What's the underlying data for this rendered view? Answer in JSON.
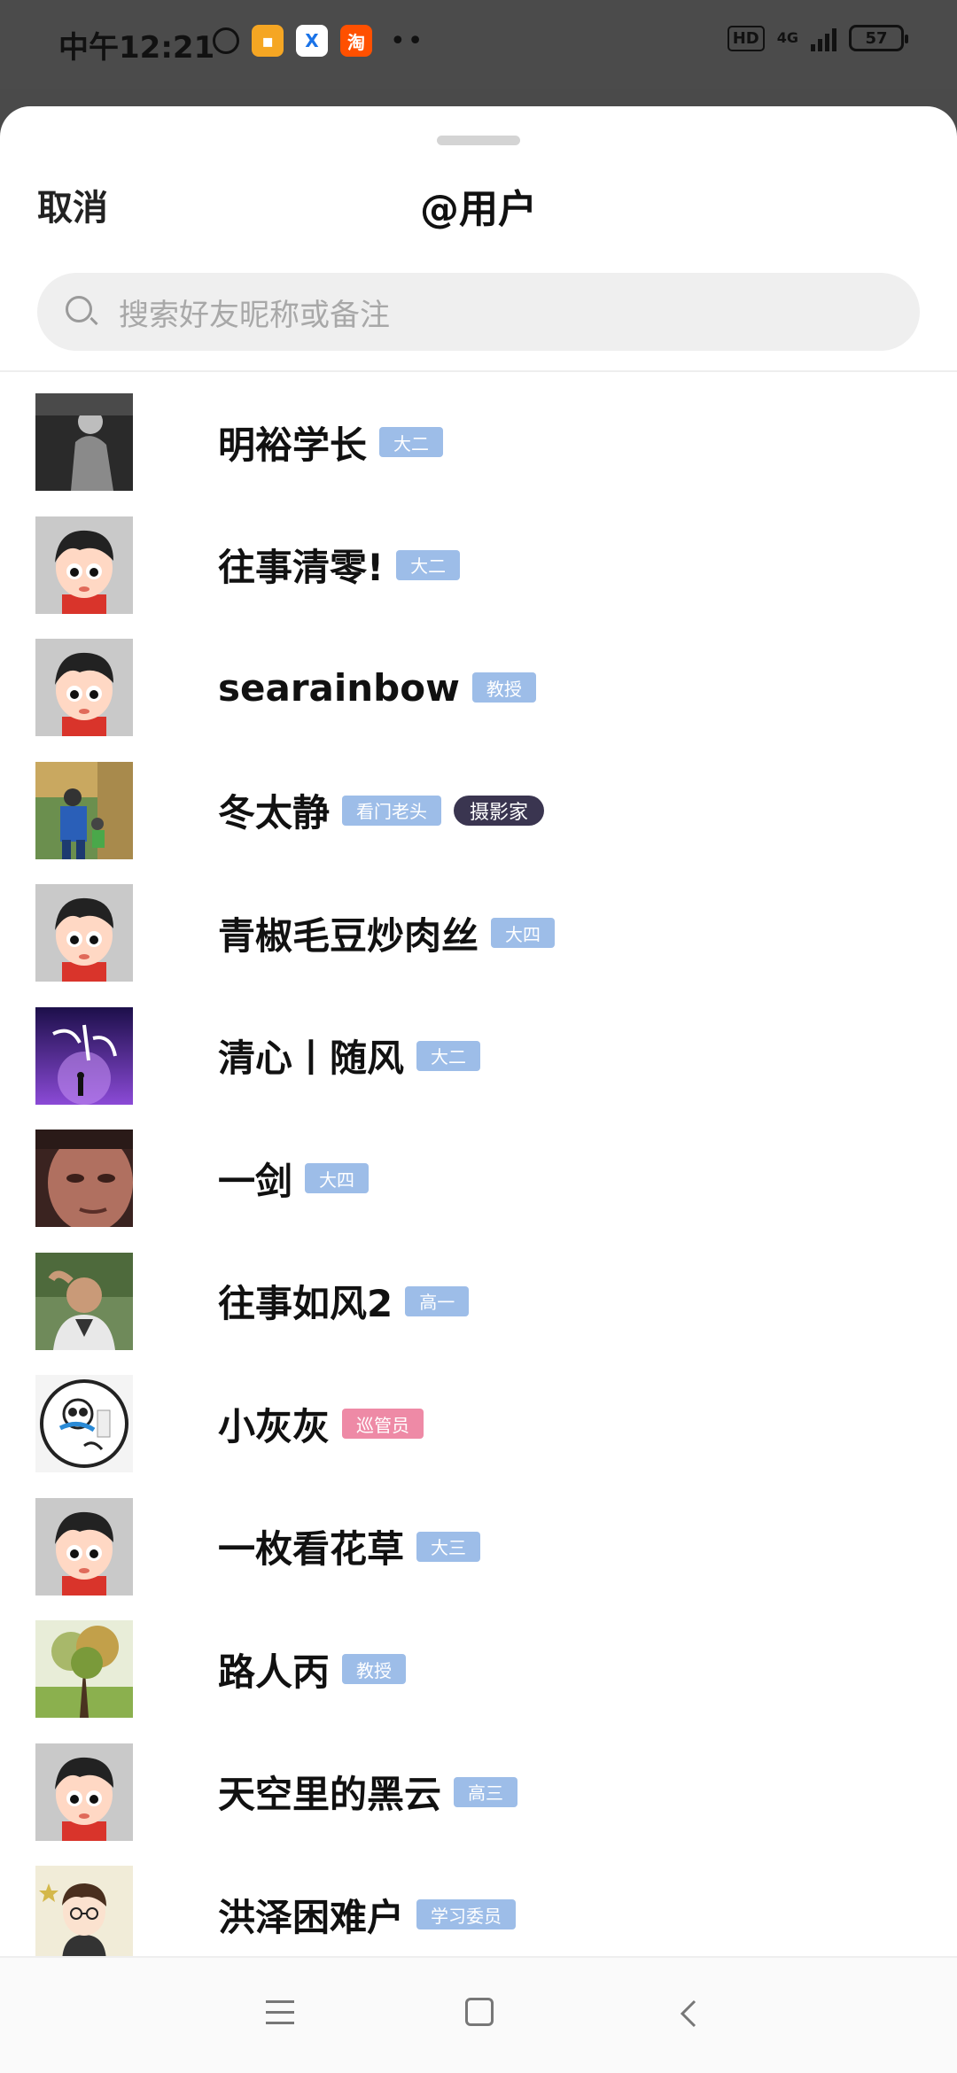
{
  "status_bar": {
    "time": "中午12:21",
    "hd_label": "HD",
    "network": "4G",
    "battery": "57"
  },
  "header": {
    "cancel_label": "取消",
    "title": "@用户"
  },
  "search": {
    "placeholder": "搜索好友昵称或备注"
  },
  "users": [
    {
      "name": "明裕学长",
      "badge": "大二",
      "avatar": "photo-bw"
    },
    {
      "name": "往事清零!",
      "badge": "大二",
      "avatar": "default-cartoon"
    },
    {
      "name": "searainbow",
      "badge": "教授",
      "avatar": "default-cartoon"
    },
    {
      "name": "冬太静",
      "badge": "看门老头",
      "badge2": "摄影家",
      "avatar": "photo-forest"
    },
    {
      "name": "青椒毛豆炒肉丝",
      "badge": "大四",
      "avatar": "default-cartoon"
    },
    {
      "name": "清心丨随风",
      "badge": "大二",
      "avatar": "photo-purple"
    },
    {
      "name": "一剑",
      "badge": "大四",
      "avatar": "photo-face"
    },
    {
      "name": "往事如风2",
      "badge": "高一",
      "avatar": "photo-man"
    },
    {
      "name": "小灰灰",
      "badge": "巡管员",
      "badge_color": "pink",
      "avatar": "panda-logo"
    },
    {
      "name": "一枚看花草",
      "badge": "大三",
      "avatar": "default-cartoon"
    },
    {
      "name": "路人丙",
      "badge": "教授",
      "avatar": "photo-tree"
    },
    {
      "name": "天空里的黑云",
      "badge": "高三",
      "avatar": "default-cartoon"
    },
    {
      "name": "洪泽困难户",
      "badge": "学习委员",
      "avatar": "cartoon-glasses"
    }
  ]
}
